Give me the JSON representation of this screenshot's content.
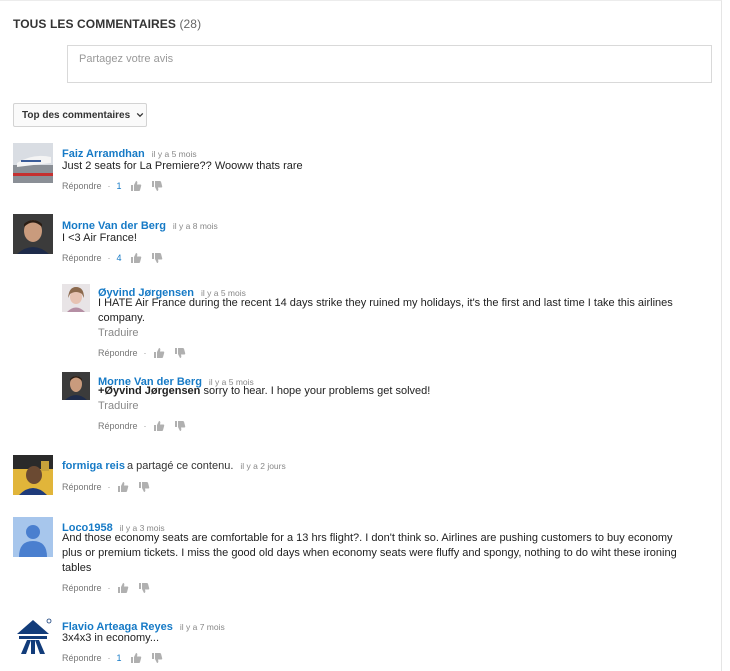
{
  "header": {
    "title": "TOUS LES COMMENTAIRES",
    "count": "(28)"
  },
  "share": {
    "placeholder": "Partagez votre avis"
  },
  "sort": {
    "label": "Top des commentaires"
  },
  "labels": {
    "reply": "Répondre",
    "translate": "Traduire",
    "dot": "·"
  },
  "comments": [
    {
      "author": "Faiz Arramdhan",
      "time": "il y a 5 mois",
      "text": "Just 2 seats for La Premiere?? Wooww thats rare",
      "likes": "1"
    },
    {
      "author": "Morne Van der Berg",
      "time": "il y a 8 mois",
      "text": "I <3 Air France!",
      "likes": "4"
    },
    {
      "author": "Øyvind Jørgensen",
      "time": "il y a 5 mois",
      "text_line1": "I HATE Air France during the recent 14 days strike they ruined my holidays, it's the first and last time I take this airlines",
      "text_line2": "company."
    },
    {
      "author": "Morne Van der Berg",
      "time": "il y a 5 mois",
      "mention": "+Øyvind Jørgensen",
      "text": " sorry to hear. I hope your problems get solved!"
    },
    {
      "author": "formiga reis",
      "shared": "a partagé ce contenu.",
      "time": "il y a 2 jours"
    },
    {
      "author": "Loco1958",
      "time": "il y a 3 mois",
      "text_line1": "And those economy seats are comfortable for a 13 hrs flight?. I don't think so. Airlines are pushing customers to buy economy",
      "text_line2": "plus or premium tickets. I miss the good old days when economy seats were fluffy and spongy, nothing to do wiht these ironing",
      "text_line3": "tables"
    },
    {
      "author": "Flavio Arteaga Reyes",
      "time": "il y a 7 mois",
      "text": "3x4x3 in economy...",
      "likes": "1"
    }
  ]
}
